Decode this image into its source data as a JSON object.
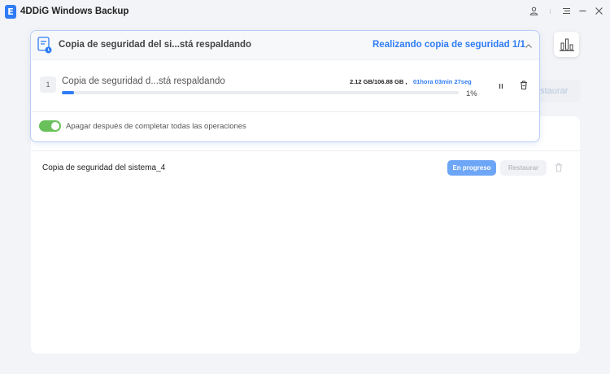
{
  "app": {
    "logo_letter": "E",
    "title": "4DDiG Windows Backup",
    "window_controls": [
      "user-icon",
      "menu-icon",
      "minimize-icon",
      "close-icon"
    ]
  },
  "popup": {
    "title": "Copia de seguridad del si...stá respaldando",
    "status": "Realizando copia de seguridad  1/1",
    "job": {
      "index": "1",
      "name": "Copia de seguridad d...stá respaldando",
      "size": "2.12 GB/106.88 GB ,",
      "time_remaining": "01hora 03min 27seg",
      "progress_percent": 1,
      "progress_label": "1%"
    },
    "shutdown_toggle": {
      "on": true,
      "label": "Apagar después de completar todas las operaciones"
    }
  },
  "background": {
    "restore_button_label": "estaurar",
    "backup_row": {
      "name": "Copia de seguridad del sistema_4",
      "status_button": "En progreso",
      "restore_button": "Restaurar"
    }
  },
  "colors": {
    "accent": "#2f7cf6",
    "toggle_on": "#6ac15b",
    "in_progress": "#6ea6f7"
  }
}
